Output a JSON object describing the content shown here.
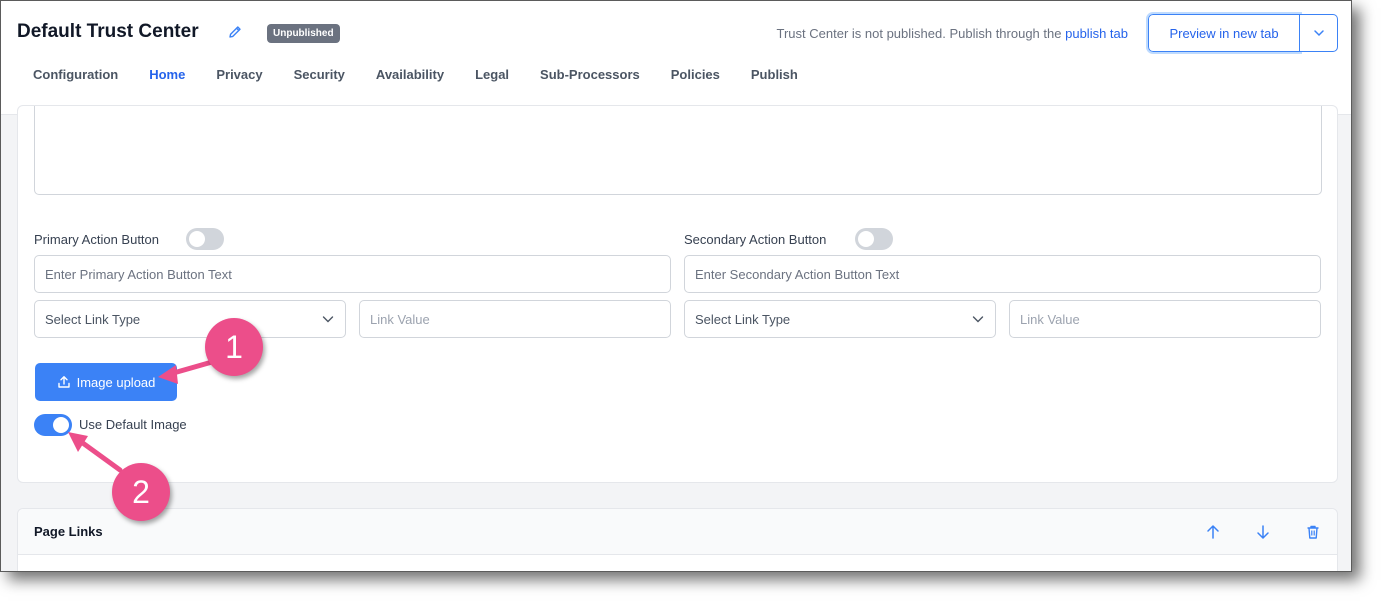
{
  "header": {
    "title": "Default Trust Center",
    "status_badge": "Unpublished",
    "publish_note": "Trust Center is not published. Publish through the",
    "publish_link": "publish tab",
    "preview_button": "Preview in new tab"
  },
  "tabs": [
    {
      "label": "Configuration"
    },
    {
      "label": "Home",
      "active": true
    },
    {
      "label": "Privacy"
    },
    {
      "label": "Security"
    },
    {
      "label": "Availability"
    },
    {
      "label": "Legal"
    },
    {
      "label": "Sub-Processors"
    },
    {
      "label": "Policies"
    },
    {
      "label": "Publish"
    }
  ],
  "form": {
    "primary": {
      "label": "Primary Action Button",
      "toggle_on": false,
      "text_placeholder": "Enter Primary Action Button Text",
      "link_type": "Select Link Type",
      "link_value_placeholder": "Link Value"
    },
    "secondary": {
      "label": "Secondary Action Button",
      "toggle_on": false,
      "text_placeholder": "Enter Secondary Action Button Text",
      "link_type": "Select Link Type",
      "link_value_placeholder": "Link Value"
    },
    "upload_button": "Image upload",
    "default_image_label": "Use Default Image",
    "default_image_on": true
  },
  "page_links": {
    "title": "Page Links"
  },
  "annotations": [
    "1",
    "2"
  ],
  "colors": {
    "accent": "#3b82f6",
    "callout": "#ec4e8a"
  }
}
